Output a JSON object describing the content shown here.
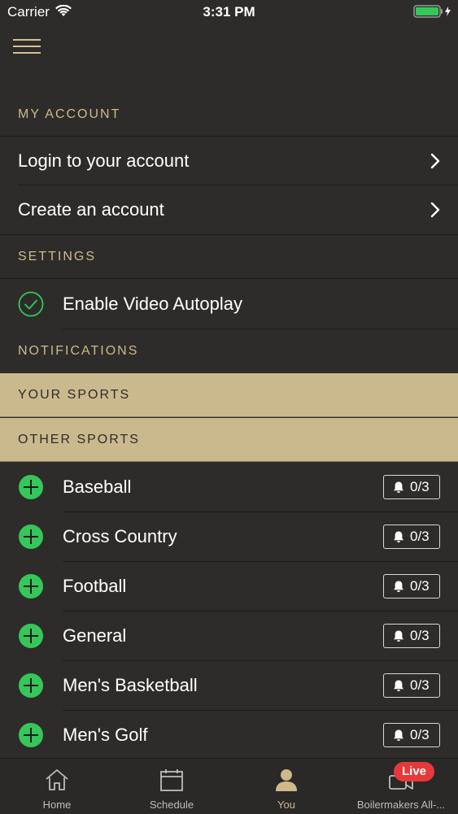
{
  "status_bar": {
    "carrier": "Carrier",
    "time": "3:31 PM"
  },
  "icons": {
    "menu": "hamburger-menu-icon",
    "chevron": "chevron-right-icon",
    "check": "check-circle-icon",
    "plus": "plus-circle-icon",
    "bell": "bell-icon"
  },
  "colors": {
    "background": "#2e2c2b",
    "gold": "#cdb98a",
    "gold_band": "#cbb98e",
    "green": "#35c759",
    "live_red": "#e8393a"
  },
  "my_account": {
    "header": "MY ACCOUNT",
    "login_label": "Login to your account",
    "create_label": "Create an account"
  },
  "settings": {
    "header": "SETTINGS",
    "autoplay_label": "Enable Video Autoplay",
    "autoplay_enabled": true
  },
  "notifications": {
    "header": "NOTIFICATIONS",
    "your_sports_header": "YOUR SPORTS",
    "other_sports_header": "OTHER SPORTS",
    "sports": [
      {
        "name": "Baseball",
        "count": "0/3"
      },
      {
        "name": "Cross Country",
        "count": "0/3"
      },
      {
        "name": "Football",
        "count": "0/3"
      },
      {
        "name": "General",
        "count": "0/3"
      },
      {
        "name": "Men's Basketball",
        "count": "0/3"
      },
      {
        "name": "Men's Golf",
        "count": "0/3"
      }
    ]
  },
  "tab_bar": {
    "tabs": [
      {
        "label": "Home",
        "icon": "home-icon"
      },
      {
        "label": "Schedule",
        "icon": "calendar-icon"
      },
      {
        "label": "You",
        "icon": "person-icon"
      },
      {
        "label": "Boilermakers All-...",
        "icon": "live-video-icon"
      }
    ],
    "active": "You",
    "live_badge": "Live"
  }
}
